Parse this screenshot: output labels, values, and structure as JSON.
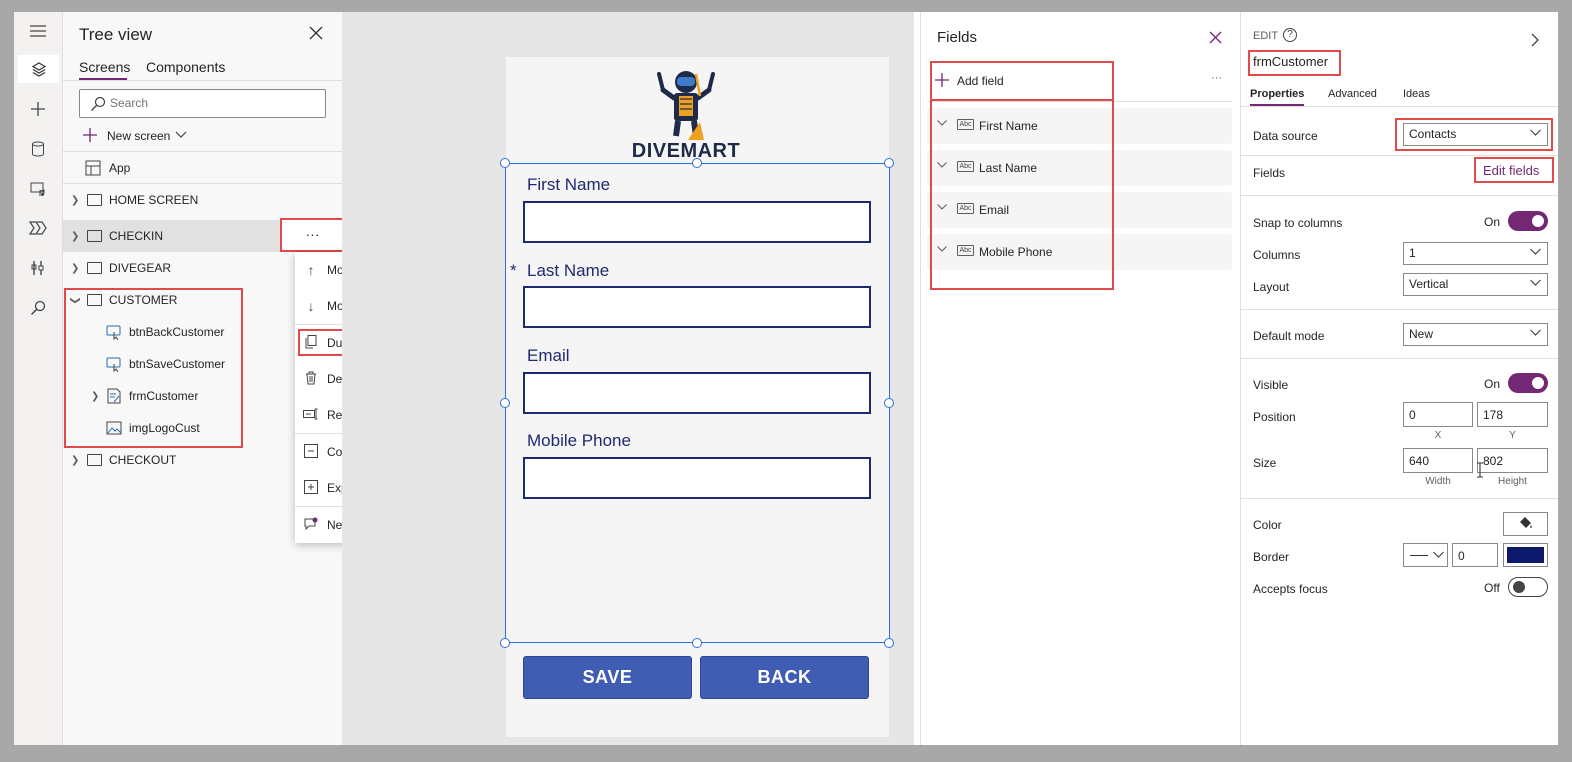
{
  "tree_view": {
    "title": "Tree view",
    "tabs": [
      "Screens",
      "Components"
    ],
    "search_placeholder": "Search",
    "new_screen": "New screen",
    "items": {
      "app": "App",
      "home": "HOME SCREEN",
      "checkin": "CHECKIN",
      "divegear": "DIVEGEAR",
      "customer": "CUSTOMER",
      "btn_back": "btnBackCustomer",
      "btn_save": "btnSaveCustomer",
      "frm": "frmCustomer",
      "img": "imgLogoCust",
      "checkout": "CHECKOUT"
    },
    "more_dots": "···"
  },
  "context_menu": {
    "move_up": "Move up",
    "move_down": "Move down",
    "duplicate": "Duplicate screen",
    "delete": "Delete",
    "rename": "Rename",
    "collapse_all": "Collapse all",
    "expand_all": "Expand all",
    "new_comment": "New comment"
  },
  "canvas": {
    "logo_text": "DIVEMART",
    "fields": [
      "First Name",
      "Last Name",
      "Email",
      "Mobile Phone"
    ],
    "required_marker": "*",
    "save": "SAVE",
    "back": "BACK"
  },
  "fields_panel": {
    "title": "Fields",
    "add_field": "Add field",
    "more": "···",
    "abc": "Abc",
    "items": [
      "First Name",
      "Last Name",
      "Email",
      "Mobile Phone"
    ]
  },
  "properties": {
    "mode": "EDIT",
    "help": "?",
    "control_name": "frmCustomer",
    "tabs": [
      "Properties",
      "Advanced",
      "Ideas"
    ],
    "data_source_label": "Data source",
    "data_source_value": "Contacts",
    "fields_label": "Fields",
    "edit_fields": "Edit fields",
    "snap_label": "Snap to columns",
    "snap_value": "On",
    "columns_label": "Columns",
    "columns_value": "1",
    "layout_label": "Layout",
    "layout_value": "Vertical",
    "default_mode_label": "Default mode",
    "default_mode_value": "New",
    "visible_label": "Visible",
    "visible_value": "On",
    "position_label": "Position",
    "pos_x": "0",
    "pos_y": "178",
    "x_cap": "X",
    "y_cap": "Y",
    "size_label": "Size",
    "width": "640",
    "height": "802",
    "width_cap": "Width",
    "height_cap": "Height",
    "color_label": "Color",
    "border_label": "Border",
    "border_value": "0",
    "border_color": "#0d1a6b",
    "accepts_focus_label": "Accepts focus",
    "accepts_focus_value": "Off"
  },
  "colors": {
    "accent": "#742774",
    "form_text": "#1f2a6e",
    "button": "#3f5db3",
    "highlight": "#e04a4a"
  }
}
